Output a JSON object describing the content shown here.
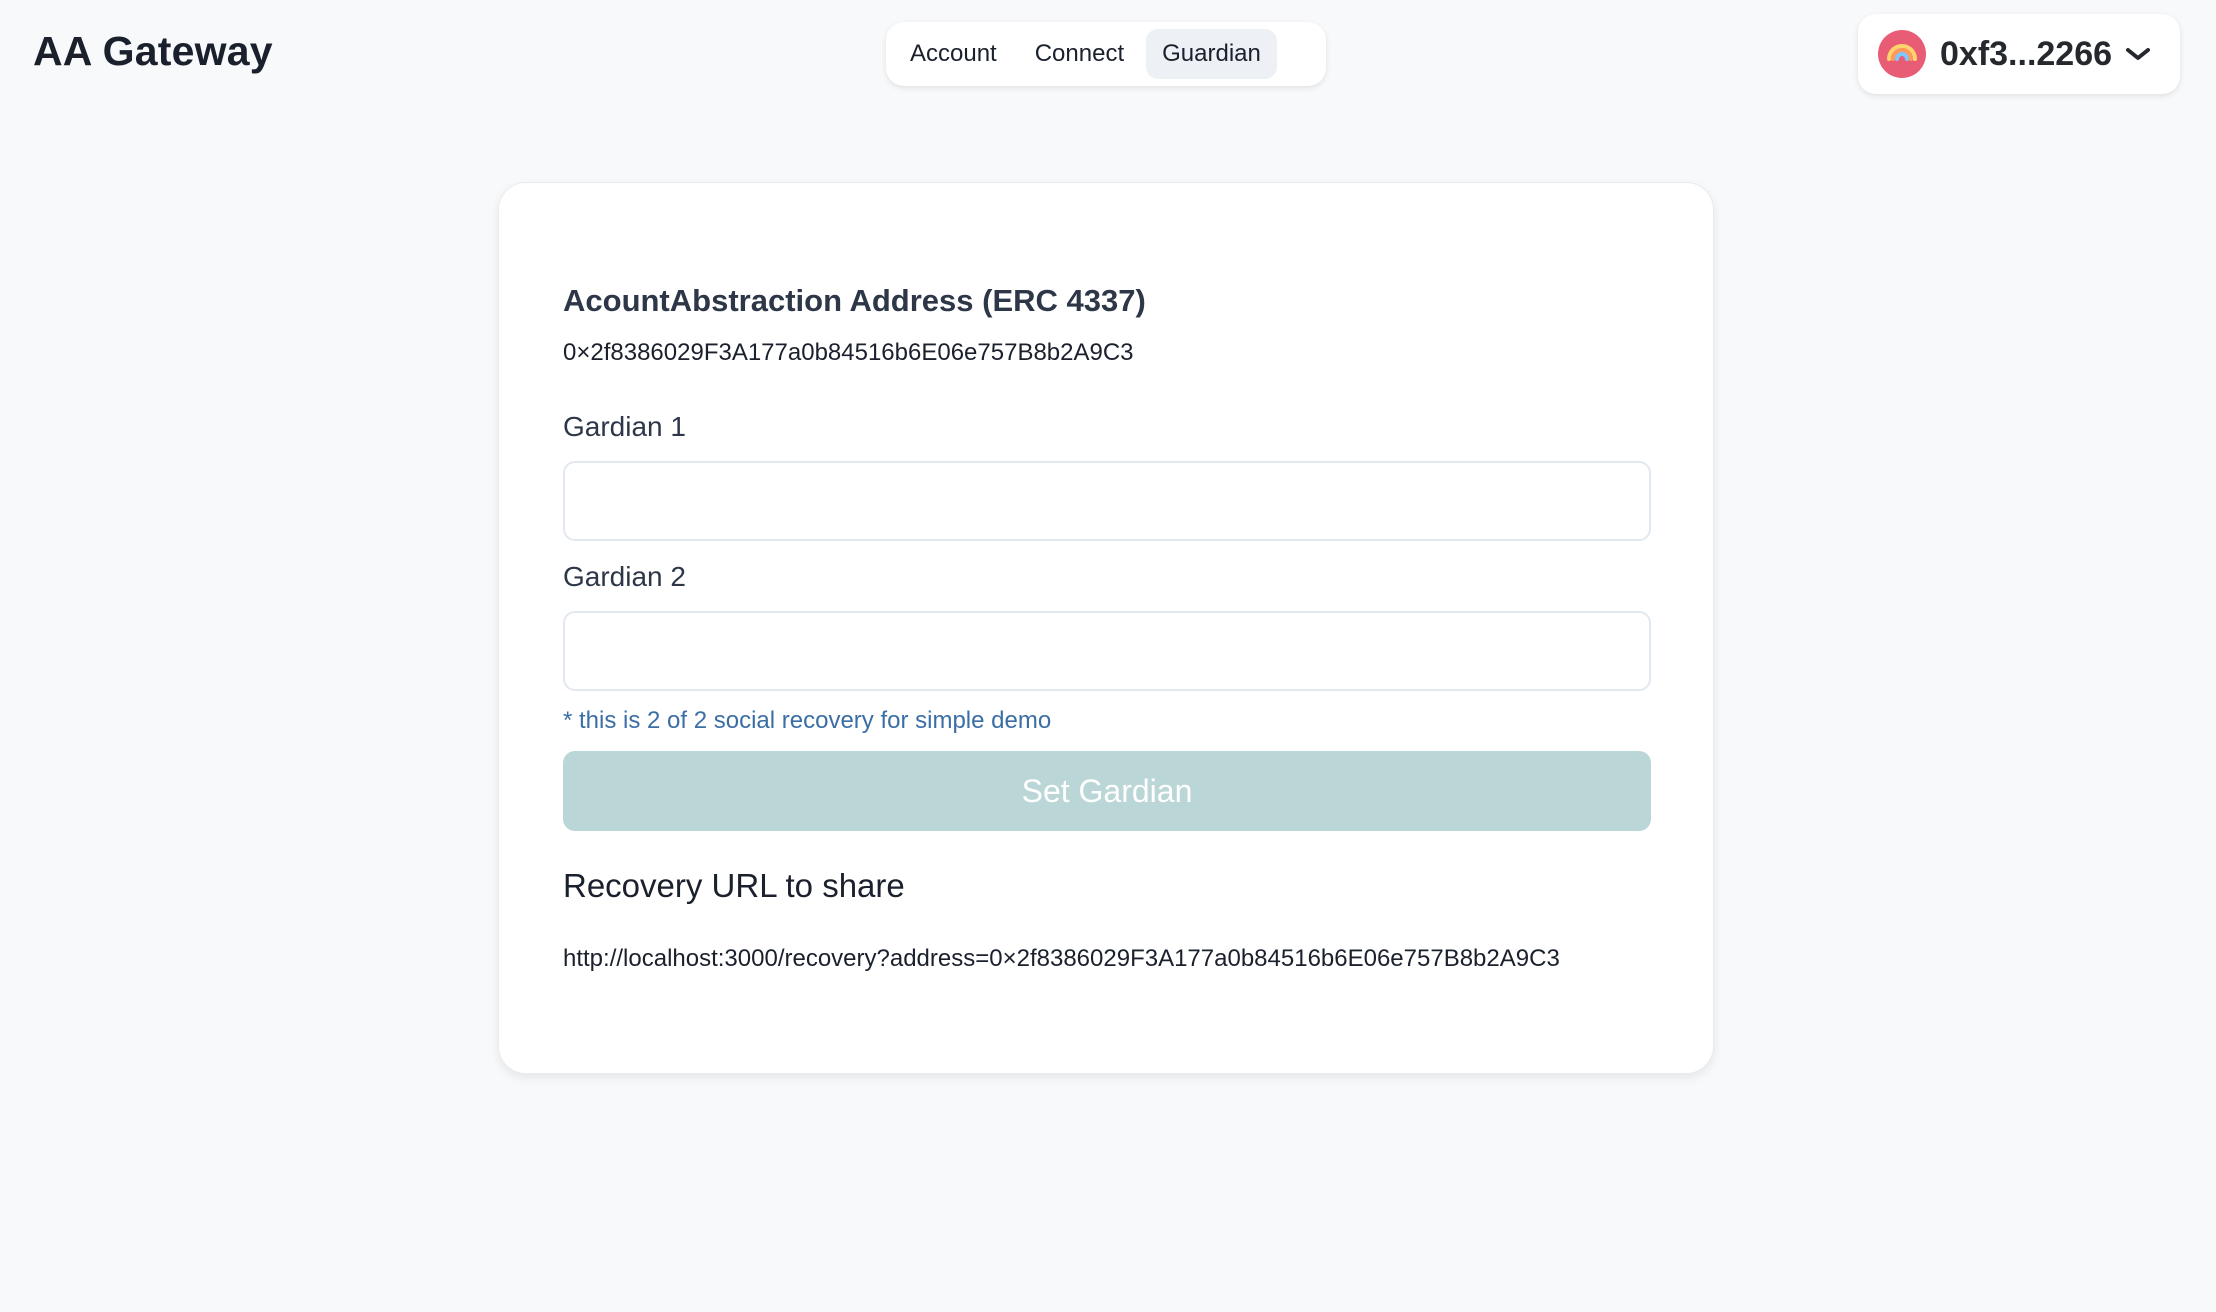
{
  "app": {
    "title": "AA Gateway"
  },
  "nav": {
    "tabs": [
      {
        "label": "Account",
        "active": false
      },
      {
        "label": "Connect",
        "active": false
      },
      {
        "label": "Guardian",
        "active": true
      }
    ]
  },
  "wallet": {
    "address": "0xf3...2266",
    "avatar_icon": "rainbow-icon",
    "avatar_color": "#e85d75",
    "chevron_icon": "chevron-down-icon"
  },
  "card": {
    "heading": "AcountAbstraction Address (ERC 4337)",
    "address": "0×2f8386029F3A177a0b84516b6E06e757B8b2A9C3",
    "guardian1": {
      "label": "Gardian 1",
      "value": "",
      "placeholder": ""
    },
    "guardian2": {
      "label": "Gardian 2",
      "value": "",
      "placeholder": ""
    },
    "note": "* this is 2 of 2 social recovery for simple demo",
    "set_button_label": "Set Gardian",
    "set_button_color": "#bad6d6",
    "recovery_title": "Recovery URL to share",
    "recovery_url": "http://localhost:3000/recovery?address=0×2f8386029F3A177a0b84516b6E06e757B8b2A9C3"
  }
}
